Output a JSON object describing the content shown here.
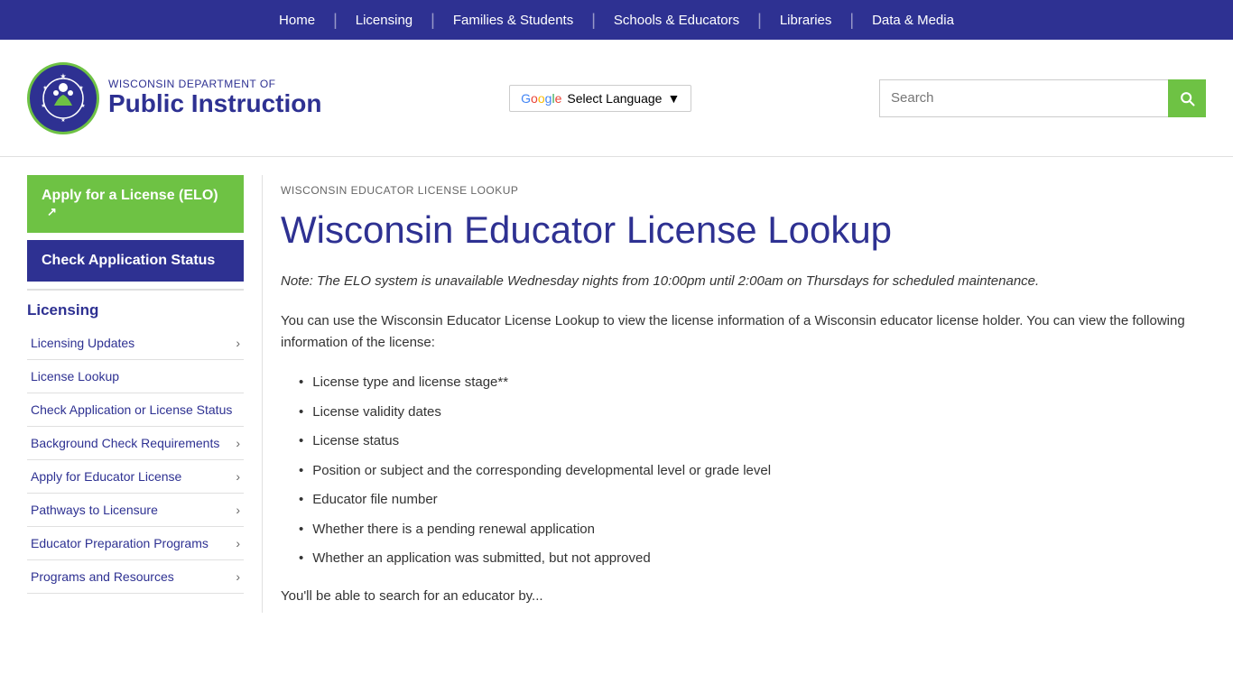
{
  "topnav": {
    "items": [
      {
        "label": "Home",
        "name": "home"
      },
      {
        "label": "Licensing",
        "name": "licensing"
      },
      {
        "label": "Families & Students",
        "name": "families-students"
      },
      {
        "label": "Schools & Educators",
        "name": "schools-educators"
      },
      {
        "label": "Libraries",
        "name": "libraries"
      },
      {
        "label": "Data & Media",
        "name": "data-media"
      }
    ]
  },
  "header": {
    "logo_top": "WISCONSIN DEPARTMENT OF",
    "logo_bottom": "Public Instruction",
    "translate_label": "Select Language",
    "search_placeholder": "Search"
  },
  "sidebar": {
    "btn_apply": "Apply for a License (ELO)",
    "btn_check": "Check Application Status",
    "section_title": "Licensing",
    "menu_items": [
      {
        "label": "Licensing Updates",
        "has_chevron": true
      },
      {
        "label": "License Lookup",
        "has_chevron": false
      },
      {
        "label": "Check Application or License Status",
        "has_chevron": false
      },
      {
        "label": "Background Check Requirements",
        "has_chevron": true
      },
      {
        "label": "Apply for Educator License",
        "has_chevron": true
      },
      {
        "label": "Pathways to Licensure",
        "has_chevron": true
      },
      {
        "label": "Educator Preparation Programs",
        "has_chevron": true
      },
      {
        "label": "Programs and Resources",
        "has_chevron": true
      }
    ]
  },
  "content": {
    "breadcrumb": "WISCONSIN EDUCATOR LICENSE LOOKUP",
    "page_title": "Wisconsin Educator License Lookup",
    "note": "Note: The ELO system is unavailable Wednesday nights from 10:00pm until 2:00am on Thursdays for scheduled maintenance.",
    "description": "You can use the Wisconsin Educator License Lookup to view the license information of a Wisconsin educator license holder. You can view the following information of the license:",
    "bullets": [
      "License type and license stage**",
      "License validity dates",
      "License status",
      "Position or subject and the corresponding developmental level or grade level",
      "Educator file number",
      "Whether there is a pending renewal application",
      "Whether an application was submitted, but not approved"
    ],
    "footer_text": "You'll be able to search for an educator by..."
  }
}
